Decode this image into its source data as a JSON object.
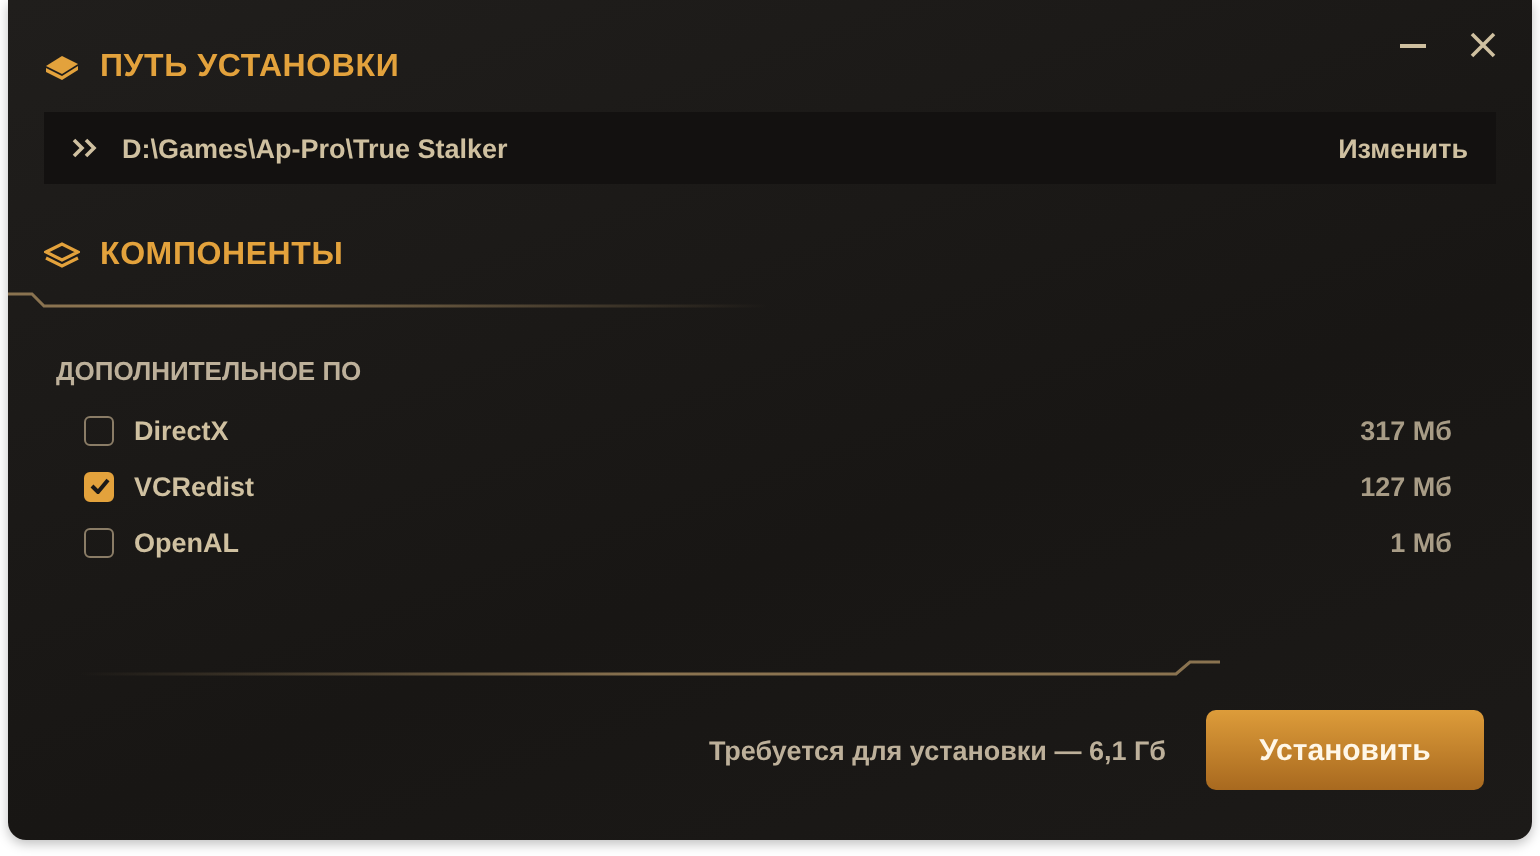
{
  "install_path": {
    "title": "ПУТЬ УСТАНОВКИ",
    "path": "D:\\Games\\Ap-Pro\\True Stalker",
    "change": "Изменить"
  },
  "components": {
    "title": "КОМПОНЕНТЫ",
    "group": "ДОПОЛНИТЕЛЬНОЕ ПО",
    "items": [
      {
        "name": "DirectX",
        "size": "317 Мб",
        "checked": false
      },
      {
        "name": "VCRedist",
        "size": "127 Мб",
        "checked": true
      },
      {
        "name": "OpenAL",
        "size": "1 Мб",
        "checked": false
      }
    ]
  },
  "footer": {
    "required": "Требуется для установки — 6,1 Гб",
    "install": "Установить"
  }
}
